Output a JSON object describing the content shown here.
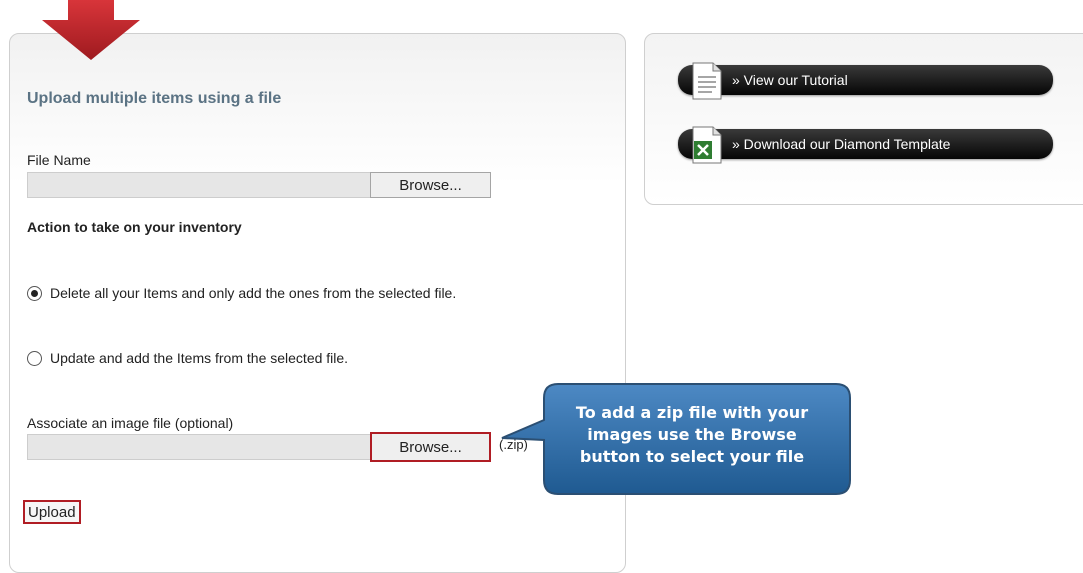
{
  "form": {
    "title": "Upload multiple items using a file",
    "file_name_label": "File Name",
    "browse_label": "Browse...",
    "action_label": "Action to take on your inventory",
    "radio_options": [
      {
        "label": "Delete all your Items and only add the ones from the selected file.",
        "selected": true
      },
      {
        "label": "Update and add the Items from the selected file.",
        "selected": false
      }
    ],
    "image_file_label": "Associate an image file (optional)",
    "image_browse_label": "Browse...",
    "zip_note": "(.zip)",
    "upload_label": "Upload"
  },
  "sidebar": {
    "links": [
      {
        "label": "» View our Tutorial",
        "icon": "document-icon"
      },
      {
        "label": "» Download our Diamond Template",
        "icon": "excel-icon"
      }
    ]
  },
  "callout": {
    "lines": [
      "To add a zip file with your",
      "images use the Browse",
      "button to select your file"
    ]
  },
  "colors": {
    "highlight": "#b01d24",
    "arrow": "#c0272d",
    "callout_fill": "#2e6aa1",
    "title_color": "#5b7384"
  }
}
